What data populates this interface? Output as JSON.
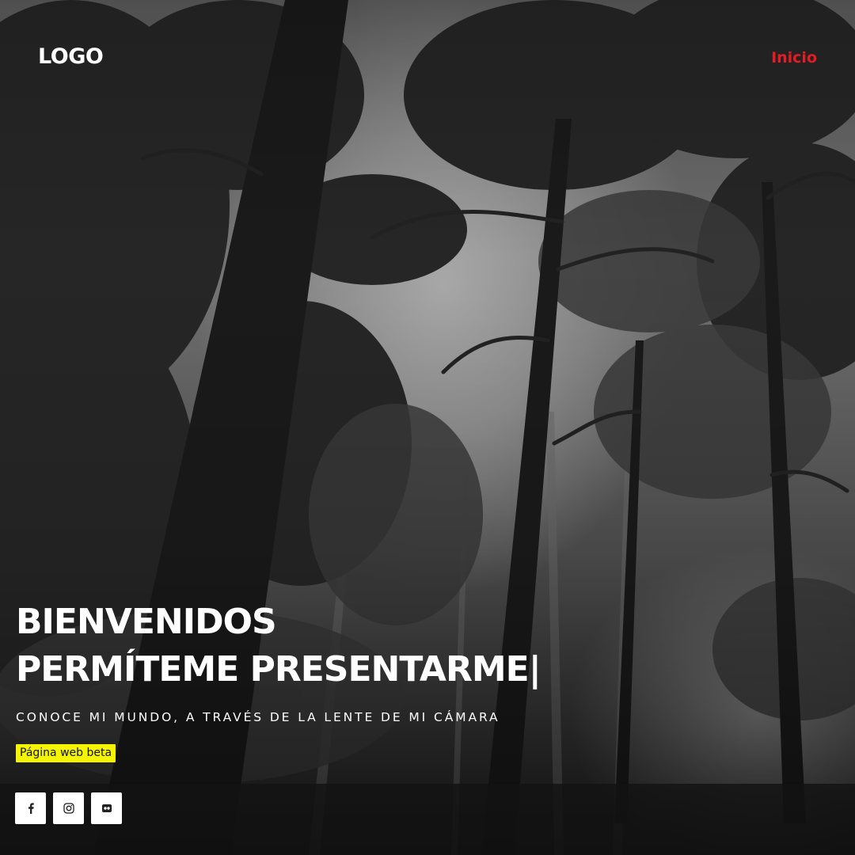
{
  "header": {
    "logo": "LOGO",
    "nav": {
      "inicio_label": "Inicio"
    }
  },
  "hero": {
    "headline_line1": "BIENVENIDOS",
    "headline_line2": "PERMÍTEME PRESENTARME",
    "cursor": "|",
    "subtitle": "CONOCE MI MUNDO, A TRAVÉS DE LA LENTE DE MI CÁMARA",
    "badge": "Página web beta"
  },
  "social": [
    {
      "icon": "facebook-icon"
    },
    {
      "icon": "instagram-icon"
    },
    {
      "icon": "flickr-icon"
    }
  ],
  "colors": {
    "nav_link": "#e51c23",
    "badge_bg": "#f5f500",
    "text": "#ffffff"
  }
}
